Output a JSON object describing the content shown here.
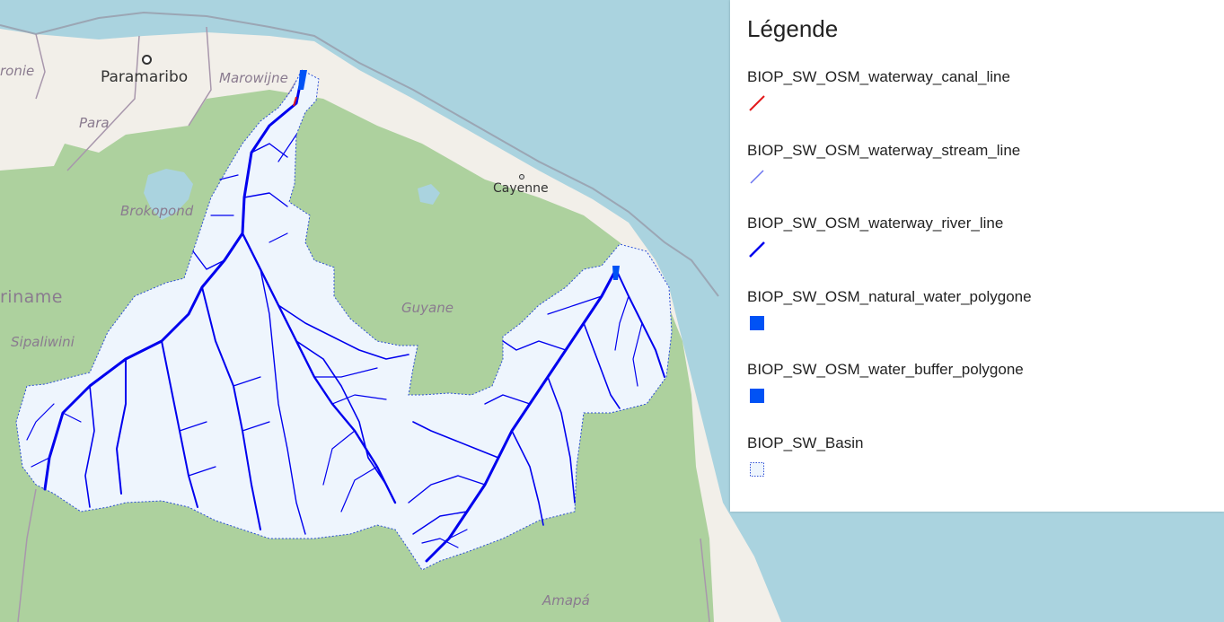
{
  "map": {
    "colors": {
      "sea": "#aad3df",
      "land": "#f2efe9",
      "forest": "#add19e",
      "basin_fill": "#eef5fd",
      "river": "#0000ee",
      "canal": "#e31a1c"
    },
    "places": {
      "paramaribo": "Paramaribo",
      "marowijne": "Marowijne",
      "coronie": "ronie",
      "para": "Para",
      "brokopondo": "Brokopond",
      "suriname": "riname",
      "sipaliwini": "Sipaliwini",
      "cayenne": "Cayenne",
      "guyane": "Guyane",
      "amapa": "Amapá"
    }
  },
  "legend": {
    "title": "Légende",
    "items": [
      {
        "label": "BIOP_SW_OSM_waterway_canal_line",
        "symbol": "line",
        "color": "#e31a1c"
      },
      {
        "label": "BIOP_SW_OSM_waterway_stream_line",
        "symbol": "line",
        "color": "#6b74f0"
      },
      {
        "label": "BIOP_SW_OSM_waterway_river_line",
        "symbol": "line",
        "color": "#0000ee"
      },
      {
        "label": "BIOP_SW_OSM_natural_water_polygone",
        "symbol": "fill",
        "color": "#0052f5"
      },
      {
        "label": "BIOP_SW_OSM_water_buffer_polygone",
        "symbol": "fill",
        "color": "#0052f5"
      },
      {
        "label": "BIOP_SW_Basin",
        "symbol": "dotted",
        "color": "#2d4fd6"
      }
    ]
  }
}
